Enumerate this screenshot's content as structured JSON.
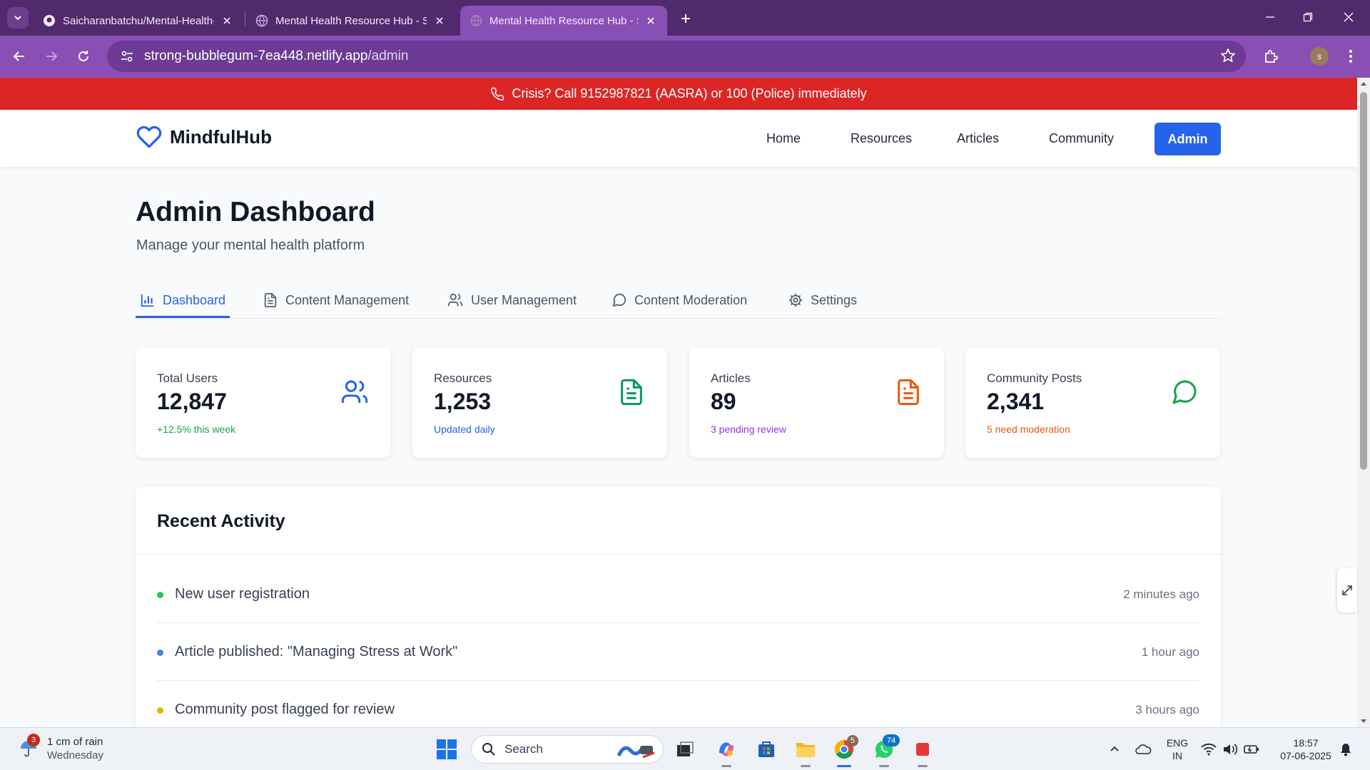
{
  "browser": {
    "tabs": [
      {
        "title": "Saicharanbatchu/Mental-Health-Resource-Hub",
        "active": false
      },
      {
        "title": "Mental Health Resource Hub - S",
        "active": false
      },
      {
        "title": "Mental Health Resource Hub - S",
        "active": true
      }
    ],
    "url_host": "strong-bubblegum-7ea448.netlify.app",
    "url_path": "/admin",
    "profile_initial": "s"
  },
  "crisis_banner": "Crisis? Call 9152987821 (AASRA) or 100 (Police) immediately",
  "header": {
    "brand": "MindfulHub",
    "nav": [
      "Home",
      "Resources",
      "Articles",
      "Community"
    ],
    "admin_label": "Admin"
  },
  "page": {
    "title": "Admin Dashboard",
    "subtitle": "Manage your mental health platform"
  },
  "admin_tabs": [
    {
      "label": "Dashboard",
      "icon": "bar-chart-icon",
      "active": true
    },
    {
      "label": "Content Management",
      "icon": "document-icon",
      "active": false
    },
    {
      "label": "User Management",
      "icon": "users-icon",
      "active": false
    },
    {
      "label": "Content Moderation",
      "icon": "message-circle-icon",
      "active": false
    },
    {
      "label": "Settings",
      "icon": "gear-icon",
      "active": false
    }
  ],
  "stats": [
    {
      "label": "Total Users",
      "value": "12,847",
      "note": "+12.5% this week",
      "note_color": "#16a34a",
      "icon": "users-icon",
      "icon_color": "#2563eb"
    },
    {
      "label": "Resources",
      "value": "1,253",
      "note": "Updated daily",
      "note_color": "#2563eb",
      "icon": "document-icon",
      "icon_color": "#059669"
    },
    {
      "label": "Articles",
      "value": "89",
      "note": "3 pending review",
      "note_color": "#9333ea",
      "icon": "document-icon",
      "icon_color": "#ea580c"
    },
    {
      "label": "Community Posts",
      "value": "2,341",
      "note": "5 need moderation",
      "note_color": "#ea580c",
      "icon": "message-circle-icon",
      "icon_color": "#16a34a"
    }
  ],
  "recent_activity": {
    "title": "Recent Activity",
    "items": [
      {
        "text": "New user registration",
        "time": "2 minutes ago",
        "dot_color": "#22c55e"
      },
      {
        "text": "Article published: \"Managing Stress at Work\"",
        "time": "1 hour ago",
        "dot_color": "#3b82f6"
      },
      {
        "text": "Community post flagged for review",
        "time": "3 hours ago",
        "dot_color": "#eab308"
      }
    ]
  },
  "taskbar": {
    "weather_badge": "3",
    "weather_line1": "1 cm of rain",
    "weather_line2": "Wednesday",
    "search_label": "Search",
    "chrome_badge": "5",
    "whatsapp_badge": "74",
    "lang_line1": "ENG",
    "lang_line2": "IN",
    "time": "18:57",
    "date": "07-06-2025"
  },
  "colors": {
    "brand": "#2563eb",
    "crisis": "#dc2626",
    "chrome_frame": "#512a6e",
    "chrome_toolbar": "#8a4fb5"
  }
}
